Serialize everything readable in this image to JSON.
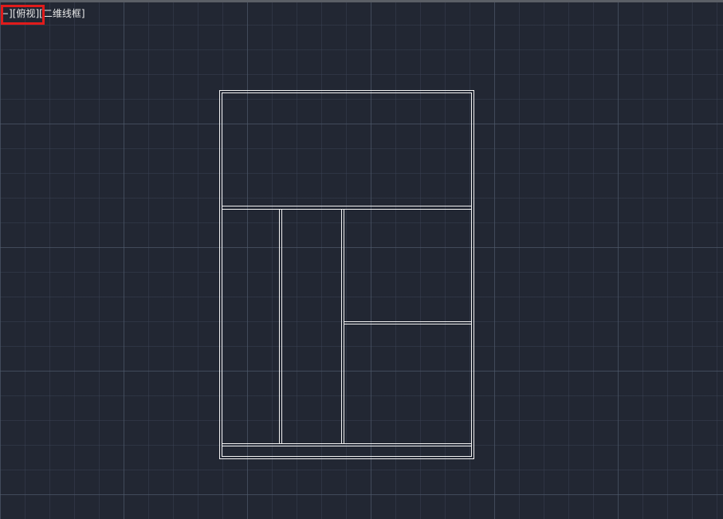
{
  "viewport": {
    "controls": {
      "menu_label": "−][",
      "view_label": "俯视",
      "separator": "][",
      "visual_style_label": "二维线框",
      "closing": "]"
    },
    "highlight_color": "#e01b1b",
    "background_color": "#222733",
    "line_color": "#f2f2f2"
  }
}
